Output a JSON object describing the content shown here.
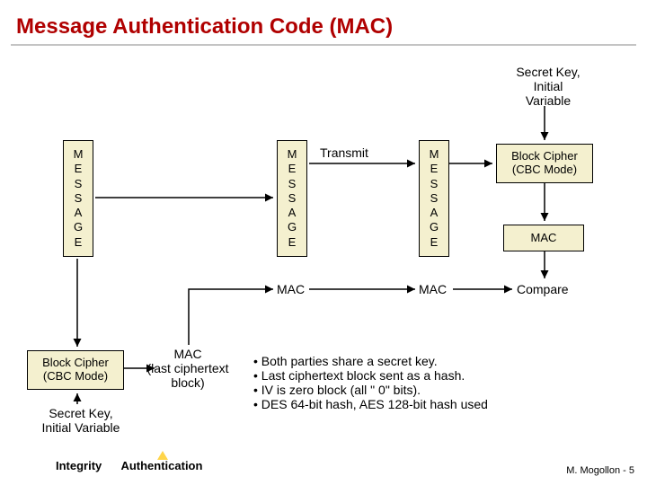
{
  "title": "Message Authentication Code (MAC)",
  "secret_key_top": "Secret Key,\nInitial\nVariable",
  "message_vertical": "M\nE\nS\nS\nA\nG\nE",
  "transmit": "Transmit",
  "block_cipher": "Block Cipher\n(CBC Mode)",
  "mac": "MAC",
  "mac_sender": "MAC",
  "mac_receiver": "MAC",
  "compare": "Compare",
  "mac_last": "MAC\n(last ciphertext\nblock)",
  "secret_key_left": "Secret Key,\nInitial Variable",
  "bullets": [
    "Both parties share a secret key.",
    "Last ciphertext block sent as a hash.",
    "IV is zero block (all \" 0\" bits).",
    "DES 64-bit hash, AES 128-bit hash used"
  ],
  "footer": {
    "integrity": "Integrity",
    "auth": "Authentication",
    "credit": "M. Mogollon  - 5"
  }
}
